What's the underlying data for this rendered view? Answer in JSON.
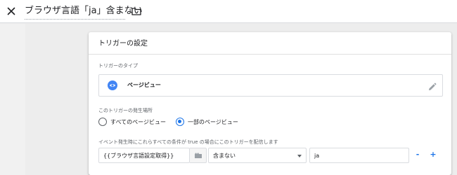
{
  "header": {
    "title": "ブラウザ言語「ja」含まない"
  },
  "card": {
    "title": "トリガーの設定",
    "type_section": {
      "label": "トリガーのタイプ",
      "type_name": "ページビュー"
    },
    "fire_section": {
      "label": "このトリガーの発生場所",
      "options": [
        {
          "label": "すべてのページビュー",
          "selected": false
        },
        {
          "label": "一部のページビュー",
          "selected": true
        }
      ]
    },
    "condition_section": {
      "label": "イベント発生時にこれらすべての条件が true の場合にこのトリガーを配信します",
      "variable": "{{ブラウザ言語設定取得}}",
      "operator": "含まない",
      "value": "ja",
      "remove_label": "-",
      "add_label": "+"
    }
  },
  "colors": {
    "accent": "#1a73e8",
    "type_icon": "#4285f4",
    "background": "#ededed"
  },
  "icons": {
    "close": "close-icon",
    "folder": "folder-icon",
    "type": "eye-icon",
    "edit": "pencil-icon",
    "variable": "variable-icon",
    "dropdown": "chevron-down-icon"
  }
}
